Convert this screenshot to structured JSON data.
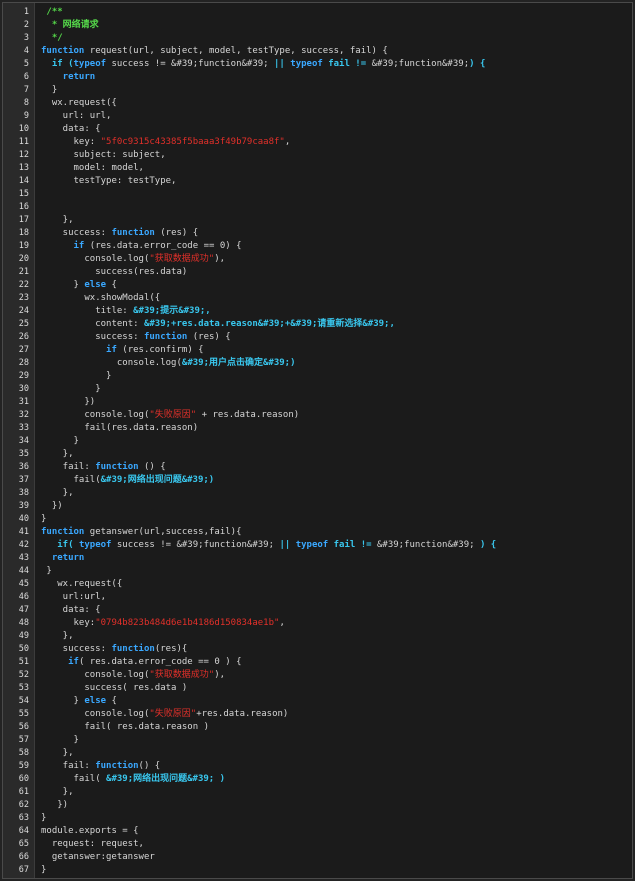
{
  "colors": {
    "background": "#1b1b1b",
    "gutter": "#2a2a2a",
    "text": "#d6d6d6",
    "keyword": "#3aa8ff",
    "string": "#e2302a",
    "comment": "#55d84a",
    "entity": "#39c7ee"
  },
  "lines": [
    {
      "n": "1",
      "i": 1,
      "t": [
        [
          "cmt",
          "/**"
        ]
      ]
    },
    {
      "n": "2",
      "i": 1,
      "t": [
        [
          "cmt",
          " * 网络请求"
        ]
      ]
    },
    {
      "n": "3",
      "i": 1,
      "t": [
        [
          "cmt",
          " */"
        ]
      ]
    },
    {
      "n": "4",
      "i": 0,
      "t": [
        [
          "kw",
          "function"
        ],
        [
          "",
          " request(url, subject, model, testType, success, fail) {"
        ]
      ]
    },
    {
      "n": "5",
      "i": 2,
      "t": [
        [
          "ent",
          "if ("
        ],
        [
          "kw",
          "typeof"
        ],
        [
          "",
          " success != &#39;function&#39; "
        ],
        [
          "ent",
          "|| "
        ],
        [
          "kw",
          "typeof"
        ],
        [
          "ent",
          " fail != "
        ],
        [
          "",
          "&#39;function&#39;"
        ],
        [
          "ent",
          ") {"
        ]
      ]
    },
    {
      "n": "6",
      "i": 4,
      "t": [
        [
          "kw",
          "return"
        ]
      ]
    },
    {
      "n": "7",
      "i": 2,
      "t": [
        [
          "",
          "}"
        ]
      ]
    },
    {
      "n": "8",
      "i": 2,
      "t": [
        [
          "",
          "wx.request({"
        ]
      ]
    },
    {
      "n": "9",
      "i": 4,
      "t": [
        [
          "",
          "url: url,"
        ]
      ]
    },
    {
      "n": "10",
      "i": 4,
      "t": [
        [
          "",
          "data: {"
        ]
      ]
    },
    {
      "n": "11",
      "i": 6,
      "t": [
        [
          "",
          "key: "
        ],
        [
          "str",
          "\"5f0c9315c43385f5baaa3f49b79caa8f\""
        ],
        [
          "",
          ","
        ]
      ]
    },
    {
      "n": "12",
      "i": 6,
      "t": [
        [
          "",
          "subject: subject,"
        ]
      ]
    },
    {
      "n": "13",
      "i": 6,
      "t": [
        [
          "",
          "model: model,"
        ]
      ]
    },
    {
      "n": "14",
      "i": 6,
      "t": [
        [
          "",
          "testType: testType,"
        ]
      ]
    },
    {
      "n": "15",
      "i": 0,
      "t": []
    },
    {
      "n": "16",
      "i": 0,
      "t": []
    },
    {
      "n": "17",
      "i": 4,
      "t": [
        [
          "",
          "},"
        ]
      ]
    },
    {
      "n": "18",
      "i": 4,
      "t": [
        [
          "",
          "success: "
        ],
        [
          "kw",
          "function"
        ],
        [
          "",
          " (res) {"
        ]
      ]
    },
    {
      "n": "19",
      "i": 6,
      "t": [
        [
          "kw",
          "if"
        ],
        [
          "",
          " (res.data.error_code == 0) {"
        ]
      ]
    },
    {
      "n": "20",
      "i": 8,
      "t": [
        [
          "",
          "console.log("
        ],
        [
          "str",
          "\"获取数据成功\""
        ],
        [
          "",
          "),"
        ]
      ]
    },
    {
      "n": "21",
      "i": 10,
      "t": [
        [
          "",
          "success(res.data)"
        ]
      ]
    },
    {
      "n": "22",
      "i": 6,
      "t": [
        [
          "",
          "} "
        ],
        [
          "kw",
          "else"
        ],
        [
          "",
          " {"
        ]
      ]
    },
    {
      "n": "23",
      "i": 8,
      "t": [
        [
          "",
          "wx.showModal({"
        ]
      ]
    },
    {
      "n": "24",
      "i": 10,
      "t": [
        [
          "",
          "title: "
        ],
        [
          "ent",
          "&#39;提示&#39;,"
        ]
      ]
    },
    {
      "n": "25",
      "i": 10,
      "t": [
        [
          "",
          "content: "
        ],
        [
          "ent",
          "&#39;+res.data.reason&#39;+&#39;请重新选择&#39;,"
        ]
      ]
    },
    {
      "n": "26",
      "i": 10,
      "t": [
        [
          "",
          "success: "
        ],
        [
          "kw",
          "function"
        ],
        [
          "",
          " (res) {"
        ]
      ]
    },
    {
      "n": "27",
      "i": 12,
      "t": [
        [
          "kw",
          "if"
        ],
        [
          "",
          " (res.confirm) {"
        ]
      ]
    },
    {
      "n": "28",
      "i": 14,
      "t": [
        [
          "",
          "console.log("
        ],
        [
          "ent",
          "&#39;用户点击确定&#39;)"
        ]
      ]
    },
    {
      "n": "29",
      "i": 12,
      "t": [
        [
          "",
          "}"
        ]
      ]
    },
    {
      "n": "30",
      "i": 10,
      "t": [
        [
          "",
          "}"
        ]
      ]
    },
    {
      "n": "31",
      "i": 8,
      "t": [
        [
          "",
          "})"
        ]
      ]
    },
    {
      "n": "32",
      "i": 8,
      "t": [
        [
          "",
          "console.log("
        ],
        [
          "str",
          "\"失败原因\""
        ],
        [
          "",
          " + res.data.reason)"
        ]
      ]
    },
    {
      "n": "33",
      "i": 8,
      "t": [
        [
          "",
          "fail(res.data.reason)"
        ]
      ]
    },
    {
      "n": "34",
      "i": 6,
      "t": [
        [
          "",
          "}"
        ]
      ]
    },
    {
      "n": "35",
      "i": 4,
      "t": [
        [
          "",
          "},"
        ]
      ]
    },
    {
      "n": "36",
      "i": 4,
      "t": [
        [
          "",
          "fail: "
        ],
        [
          "kw",
          "function"
        ],
        [
          "",
          " () {"
        ]
      ]
    },
    {
      "n": "37",
      "i": 6,
      "t": [
        [
          "",
          "fail("
        ],
        [
          "ent",
          "&#39;网络出现问题&#39;)"
        ]
      ]
    },
    {
      "n": "38",
      "i": 4,
      "t": [
        [
          "",
          "},"
        ]
      ]
    },
    {
      "n": "39",
      "i": 2,
      "t": [
        [
          "",
          "})"
        ]
      ]
    },
    {
      "n": "40",
      "i": 0,
      "t": [
        [
          "",
          "}"
        ]
      ]
    },
    {
      "n": "41",
      "i": 0,
      "t": [
        [
          "kw",
          "function"
        ],
        [
          "",
          " getanswer(url,success,fail){"
        ]
      ]
    },
    {
      "n": "42",
      "i": 3,
      "t": [
        [
          "ent",
          "if( "
        ],
        [
          "kw",
          "typeof"
        ],
        [
          "",
          " success != &#39;function&#39; "
        ],
        [
          "ent",
          "|| "
        ],
        [
          "kw",
          "typeof"
        ],
        [
          "ent",
          " fail != "
        ],
        [
          "",
          "&#39;function&#39; "
        ],
        [
          "ent",
          ") {"
        ]
      ]
    },
    {
      "n": "43",
      "i": 2,
      "t": [
        [
          "kw",
          "return"
        ]
      ]
    },
    {
      "n": "44",
      "i": 1,
      "t": [
        [
          "",
          "}"
        ]
      ]
    },
    {
      "n": "45",
      "i": 3,
      "t": [
        [
          "",
          "wx.request({"
        ]
      ]
    },
    {
      "n": "46",
      "i": 4,
      "t": [
        [
          "",
          "url:url,"
        ]
      ]
    },
    {
      "n": "47",
      "i": 4,
      "t": [
        [
          "",
          "data: {"
        ]
      ]
    },
    {
      "n": "48",
      "i": 6,
      "t": [
        [
          "",
          "key:"
        ],
        [
          "str",
          "\"0794b823b484d6e1b4186d150834ae1b\""
        ],
        [
          "",
          ","
        ]
      ]
    },
    {
      "n": "49",
      "i": 4,
      "t": [
        [
          "",
          "},"
        ]
      ]
    },
    {
      "n": "50",
      "i": 4,
      "t": [
        [
          "",
          "success: "
        ],
        [
          "kw",
          "function"
        ],
        [
          "",
          "(res){"
        ]
      ]
    },
    {
      "n": "51",
      "i": 5,
      "t": [
        [
          "kw",
          "if"
        ],
        [
          "",
          "( res.data.error_code == 0 ) {"
        ]
      ]
    },
    {
      "n": "52",
      "i": 8,
      "t": [
        [
          "",
          "console.log("
        ],
        [
          "str",
          "\"获取数据成功\""
        ],
        [
          "",
          "),"
        ]
      ]
    },
    {
      "n": "53",
      "i": 8,
      "t": [
        [
          "",
          "success( res.data )"
        ]
      ]
    },
    {
      "n": "54",
      "i": 6,
      "t": [
        [
          "",
          "} "
        ],
        [
          "kw",
          "else"
        ],
        [
          "",
          " {"
        ]
      ]
    },
    {
      "n": "55",
      "i": 8,
      "t": [
        [
          "",
          "console.log("
        ],
        [
          "str",
          "\"失败原因\""
        ],
        [
          "",
          "+res.data.reason)"
        ]
      ]
    },
    {
      "n": "56",
      "i": 8,
      "t": [
        [
          "",
          "fail( res.data.reason )"
        ]
      ]
    },
    {
      "n": "57",
      "i": 6,
      "t": [
        [
          "",
          "}"
        ]
      ]
    },
    {
      "n": "58",
      "i": 4,
      "t": [
        [
          "",
          "},"
        ]
      ]
    },
    {
      "n": "59",
      "i": 4,
      "t": [
        [
          "",
          "fail: "
        ],
        [
          "kw",
          "function"
        ],
        [
          "",
          "() {"
        ]
      ]
    },
    {
      "n": "60",
      "i": 6,
      "t": [
        [
          "",
          "fail( "
        ],
        [
          "ent",
          "&#39;网络出现问题&#39; )"
        ]
      ]
    },
    {
      "n": "61",
      "i": 4,
      "t": [
        [
          "",
          "},"
        ]
      ]
    },
    {
      "n": "62",
      "i": 3,
      "t": [
        [
          "",
          "})"
        ]
      ]
    },
    {
      "n": "63",
      "i": 0,
      "t": [
        [
          "",
          "}"
        ]
      ]
    },
    {
      "n": "64",
      "i": 0,
      "t": [
        [
          "",
          "module.exports = {"
        ]
      ]
    },
    {
      "n": "65",
      "i": 2,
      "t": [
        [
          "",
          "request: request,"
        ]
      ]
    },
    {
      "n": "66",
      "i": 2,
      "t": [
        [
          "",
          "getanswer:getanswer"
        ]
      ]
    },
    {
      "n": "67",
      "i": 0,
      "t": [
        [
          "",
          "}"
        ]
      ]
    }
  ]
}
